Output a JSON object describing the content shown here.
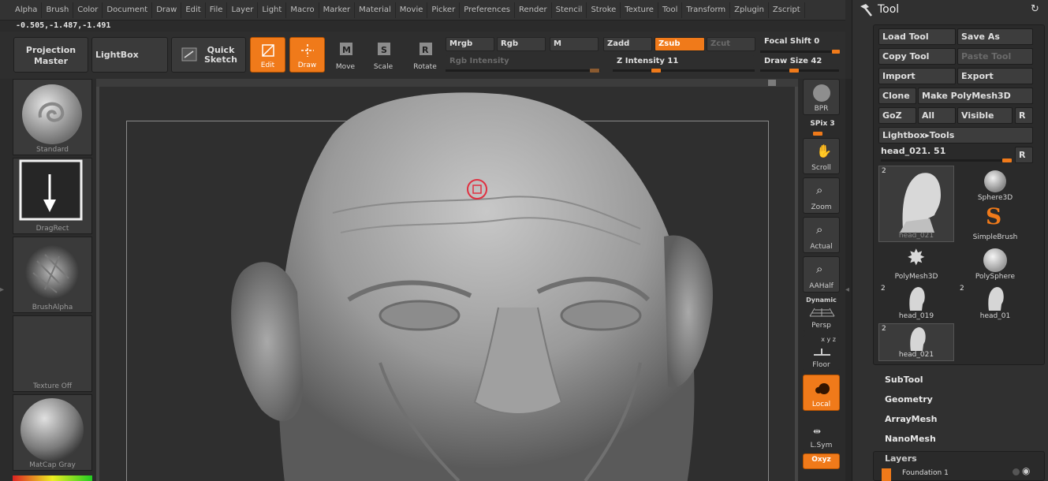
{
  "menu": [
    "Alpha",
    "Brush",
    "Color",
    "Document",
    "Draw",
    "Edit",
    "File",
    "Layer",
    "Light",
    "Macro",
    "Marker",
    "Material",
    "Movie",
    "Picker",
    "Preferences",
    "Render",
    "Stencil",
    "Stroke",
    "Texture",
    "Tool",
    "Transform",
    "Zplugin",
    "Zscript"
  ],
  "coords": "-0.505,-1.487,-1.491",
  "toolbar": {
    "projection_master": "Projection Master",
    "lightbox": "LightBox",
    "quick_sketch": "Quick Sketch",
    "edit": "Edit",
    "draw": "Draw",
    "move": "Move",
    "scale": "Scale",
    "rotate": "Rotate",
    "mrgb": "Mrgb",
    "rgb": "Rgb",
    "m": "M",
    "zadd": "Zadd",
    "zsub": "Zsub",
    "zcut": "Zcut",
    "rgb_intensity": "Rgb Intensity",
    "z_intensity": "Z Intensity 11",
    "focal_shift": "Focal Shift 0",
    "draw_size": "Draw Size 42"
  },
  "left_shelf": {
    "brush": "Standard",
    "stroke": "DragRect",
    "alpha": "BrushAlpha",
    "texture": "Texture Off",
    "material": "MatCap Gray"
  },
  "right_shelf": {
    "bpr": "BPR",
    "spix": "SPix 3",
    "scroll": "Scroll",
    "zoom": "Zoom",
    "actual": "Actual",
    "aahalf": "AAHalf",
    "dynamic": "Dynamic",
    "persp": "Persp",
    "floor_axes": "x y z",
    "floor": "Floor",
    "local": "Local",
    "lsym": "L.Sym",
    "xyz": "Oxyz"
  },
  "tool_panel": {
    "title": "Tool",
    "load_tool": "Load Tool",
    "save_as": "Save As",
    "copy_tool": "Copy Tool",
    "paste_tool": "Paste Tool",
    "import": "Import",
    "export": "Export",
    "clone": "Clone",
    "make_polymesh": "Make PolyMesh3D",
    "goz": "GoZ",
    "all": "All",
    "visible": "Visible",
    "r": "R",
    "lightbox_tools": "Lightbox▸Tools",
    "current_tool": "head_021. 51",
    "tiles": [
      {
        "name": "head_021",
        "count": "2"
      },
      {
        "name": "Sphere3D",
        "count": ""
      },
      {
        "name": "SimpleBrush",
        "count": ""
      },
      {
        "name": "PolyMesh3D",
        "count": ""
      },
      {
        "name": "PolySphere",
        "count": ""
      },
      {
        "name": "head_019",
        "count": "2"
      },
      {
        "name": "head_01",
        "count": "2"
      },
      {
        "name": "head_021",
        "count": "2"
      }
    ],
    "sections": [
      "SubTool",
      "Geometry",
      "ArrayMesh",
      "NanoMesh"
    ],
    "layers_title": "Layers",
    "layer_name": "Foundation 1"
  },
  "colors": {
    "accent": "#f07a1a"
  }
}
